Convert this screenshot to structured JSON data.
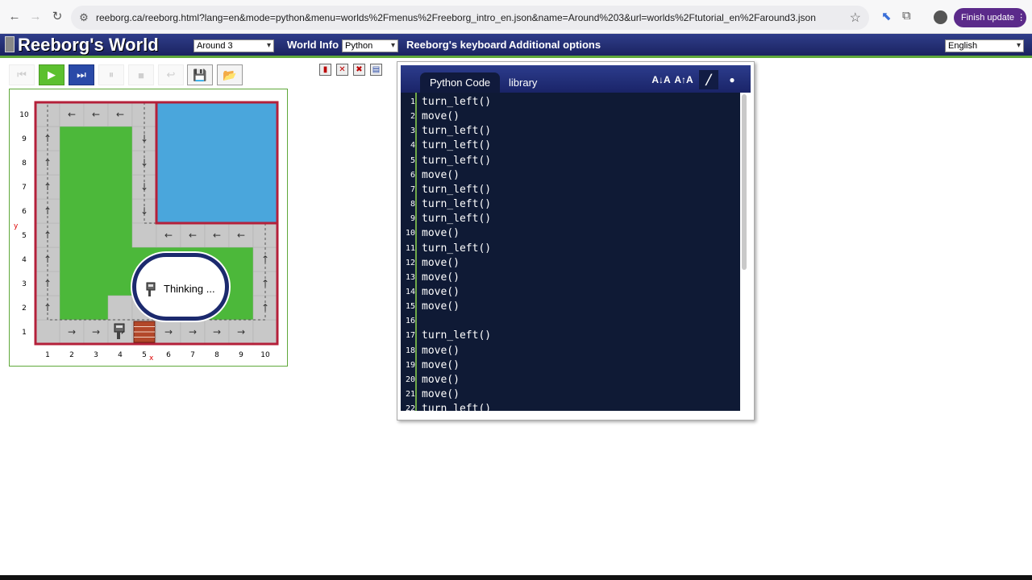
{
  "browser": {
    "url": "reeborg.ca/reeborg.html?lang=en&mode=python&menu=worlds%2Fmenus%2Freeborg_intro_en.json&name=Around%203&url=worlds%2Ftutorial_en%2Faround3.json",
    "update_label": "Finish update"
  },
  "app": {
    "title": "Reeborg's World",
    "world_select": "Around 3",
    "world_info": "World Info",
    "language_mode": "Python",
    "keyboard": "Reeborg's keyboard",
    "options": "Additional options",
    "ui_language": "English"
  },
  "world": {
    "bubble_text": "Thinking ...",
    "x_ticks": [
      "1",
      "2",
      "3",
      "4",
      "5",
      "6",
      "7",
      "8",
      "9",
      "10"
    ],
    "y_ticks": [
      "1",
      "2",
      "3",
      "4",
      "5",
      "6",
      "7",
      "8",
      "9",
      "10"
    ],
    "x_label": "x",
    "y_label": "y"
  },
  "editor": {
    "tabs": [
      "Python Code",
      "library"
    ],
    "tools": [
      "A↓A",
      "A↑A"
    ],
    "lines": [
      {
        "n": "1",
        "code": "turn_left()"
      },
      {
        "n": "2",
        "code": "move()"
      },
      {
        "n": "3",
        "code": "turn_left()"
      },
      {
        "n": "4",
        "code": "turn_left()"
      },
      {
        "n": "5",
        "code": "turn_left()"
      },
      {
        "n": "6",
        "code": "move()"
      },
      {
        "n": "7",
        "code": "turn_left()"
      },
      {
        "n": "8",
        "code": "turn_left()"
      },
      {
        "n": "9",
        "code": "turn_left()"
      },
      {
        "n": "10",
        "code": "move()"
      },
      {
        "n": "11",
        "code": "turn_left()"
      },
      {
        "n": "12",
        "code": "move()"
      },
      {
        "n": "13",
        "code": "move()"
      },
      {
        "n": "14",
        "code": "move()"
      },
      {
        "n": "15",
        "code": "move()"
      },
      {
        "n": "16",
        "code": ""
      },
      {
        "n": "17",
        "code": "turn_left()"
      },
      {
        "n": "18",
        "code": "move()"
      },
      {
        "n": "19",
        "code": "move()"
      },
      {
        "n": "20",
        "code": "move()"
      },
      {
        "n": "21",
        "code": "move()"
      },
      {
        "n": "22",
        "code": "turn_left()"
      }
    ]
  },
  "colors": {
    "grass": "#4cb83a",
    "water": "#4aa6dc",
    "path": "#c8c8c8",
    "wall": "#b4203a",
    "brick": "#b3482a"
  }
}
